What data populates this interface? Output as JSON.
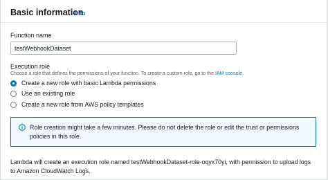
{
  "section": {
    "title": "Basic information",
    "info_link": "Info"
  },
  "function_name": {
    "label": "Function name",
    "value": "testWebhookDataset"
  },
  "execution_role": {
    "label": "Execution role",
    "description_prefix": "Choose a role that defines the permissions of your function. To create a custom role, go to the ",
    "description_link": "IAM console",
    "description_suffix": ".",
    "options": [
      {
        "label": "Create a new role with basic Lambda permissions",
        "selected": true
      },
      {
        "label": "Use an existing role",
        "selected": false
      },
      {
        "label": "Create a new role from AWS policy templates",
        "selected": false
      }
    ]
  },
  "alert": {
    "icon": "info-circle-icon",
    "text": "Role creation might take a few minutes. Please do not delete the role or edit the trust or permissions policies in this role."
  },
  "footer": {
    "text": "Lambda will create an execution role named testWebhookDataset-role-oqyx70yi, with permission to upload logs to Amazon CloudWatch Logs."
  },
  "colors": {
    "accent": "#0073bb",
    "alert_background": "#f1faff",
    "text": "#16191f",
    "muted_text": "#545b64"
  }
}
